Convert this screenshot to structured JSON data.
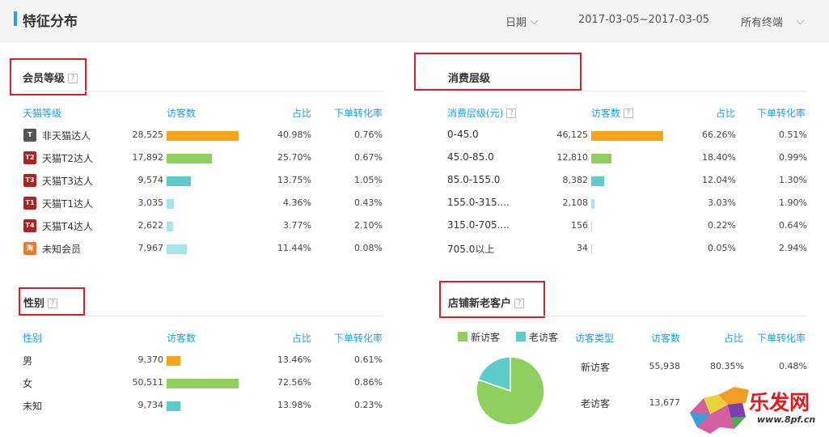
{
  "header": {
    "title": "特征分布",
    "date_label": "日期",
    "date_range": "2017-03-05~2017-03-05",
    "terminal_label": "所有终端"
  },
  "member": {
    "title": "会员等级",
    "help": "?",
    "columns": [
      "天猫等级",
      "访客数",
      "占比",
      "下单转化率"
    ],
    "rows": [
      {
        "badge": "T",
        "name": "非天猫达人",
        "visitors": "28,525",
        "share": "40.98%",
        "conversion": "0.76%",
        "ratio": 40.98
      },
      {
        "badge": "T2",
        "name": "天猫T2达人",
        "visitors": "17,892",
        "share": "25.70%",
        "conversion": "0.67%",
        "ratio": 25.7
      },
      {
        "badge": "T3",
        "name": "天猫T3达人",
        "visitors": "9,574",
        "share": "13.75%",
        "conversion": "1.05%",
        "ratio": 13.75
      },
      {
        "badge": "T1",
        "name": "天猫T1达人",
        "visitors": "3,035",
        "share": "4.36%",
        "conversion": "0.43%",
        "ratio": 4.36
      },
      {
        "badge": "T4",
        "name": "天猫T4达人",
        "visitors": "2,622",
        "share": "3.77%",
        "conversion": "2.10%",
        "ratio": 3.77
      },
      {
        "badge": "淘",
        "name": "未知会员",
        "visitors": "7,967",
        "share": "11.44%",
        "conversion": "0.08%",
        "ratio": 11.44
      }
    ]
  },
  "spending": {
    "title": "消费层级",
    "columns": [
      "消费层级(元)",
      "访客数",
      "占比",
      "下单转化率"
    ],
    "help": "?",
    "rows": [
      {
        "name": "0-45.0",
        "visitors": "46,125",
        "share": "66.26%",
        "conversion": "0.51%",
        "ratio": 66.26
      },
      {
        "name": "45.0-85.0",
        "visitors": "12,810",
        "share": "18.40%",
        "conversion": "0.99%",
        "ratio": 18.4
      },
      {
        "name": "85.0-155.0",
        "visitors": "8,382",
        "share": "12.04%",
        "conversion": "1.30%",
        "ratio": 12.04
      },
      {
        "name": "155.0-315....",
        "visitors": "2,108",
        "share": "3.03%",
        "conversion": "1.90%",
        "ratio": 3.03
      },
      {
        "name": "315.0-705....",
        "visitors": "156",
        "share": "0.22%",
        "conversion": "0.64%",
        "ratio": 0.22
      },
      {
        "name": "705.0以上",
        "visitors": "34",
        "share": "0.05%",
        "conversion": "2.94%",
        "ratio": 0.05
      }
    ]
  },
  "gender": {
    "title": "性别",
    "help": "?",
    "columns": [
      "性别",
      "访客数",
      "占比",
      "下单转化率"
    ],
    "rows": [
      {
        "name": "男",
        "visitors": "9,370",
        "share": "13.46%",
        "conversion": "0.61%",
        "ratio": 13.46
      },
      {
        "name": "女",
        "visitors": "50,511",
        "share": "72.56%",
        "conversion": "0.86%",
        "ratio": 72.56
      },
      {
        "name": "未知",
        "visitors": "9,734",
        "share": "13.98%",
        "conversion": "0.23%",
        "ratio": 13.98
      }
    ]
  },
  "customers": {
    "title": "店铺新老客户",
    "help": "?",
    "legend": [
      "新访客",
      "老访客"
    ],
    "columns": [
      "访客类型",
      "访客数",
      "占比",
      "下单转化率"
    ],
    "rows": [
      {
        "name": "新访客",
        "visitors": "55,938",
        "share": "80.35%",
        "conversion": "0.48%",
        "ratio": 80.35
      },
      {
        "name": "老访客",
        "visitors": "13,677",
        "share": "",
        "conversion": "",
        "ratio": 19.65
      }
    ]
  },
  "watermark": {
    "text": "乐发网",
    "url": "www.8pf.cn"
  },
  "colors": {
    "accent": "#27a4e4",
    "header_text": "#1e9fd8",
    "highlight_box": "#d9202a",
    "bar_palette": [
      "#f5a51c",
      "#8fcf5d",
      "#5ccbc9",
      "#a7e5ea",
      "#a7e5ea",
      "#a7e5ea"
    ],
    "pie_new": "#8fcf5d",
    "pie_old": "#5ccbc9",
    "badge_palette": [
      "#555555",
      "#b22020",
      "#b22020",
      "#b22020",
      "#b22020",
      "#e57b2b"
    ]
  }
}
